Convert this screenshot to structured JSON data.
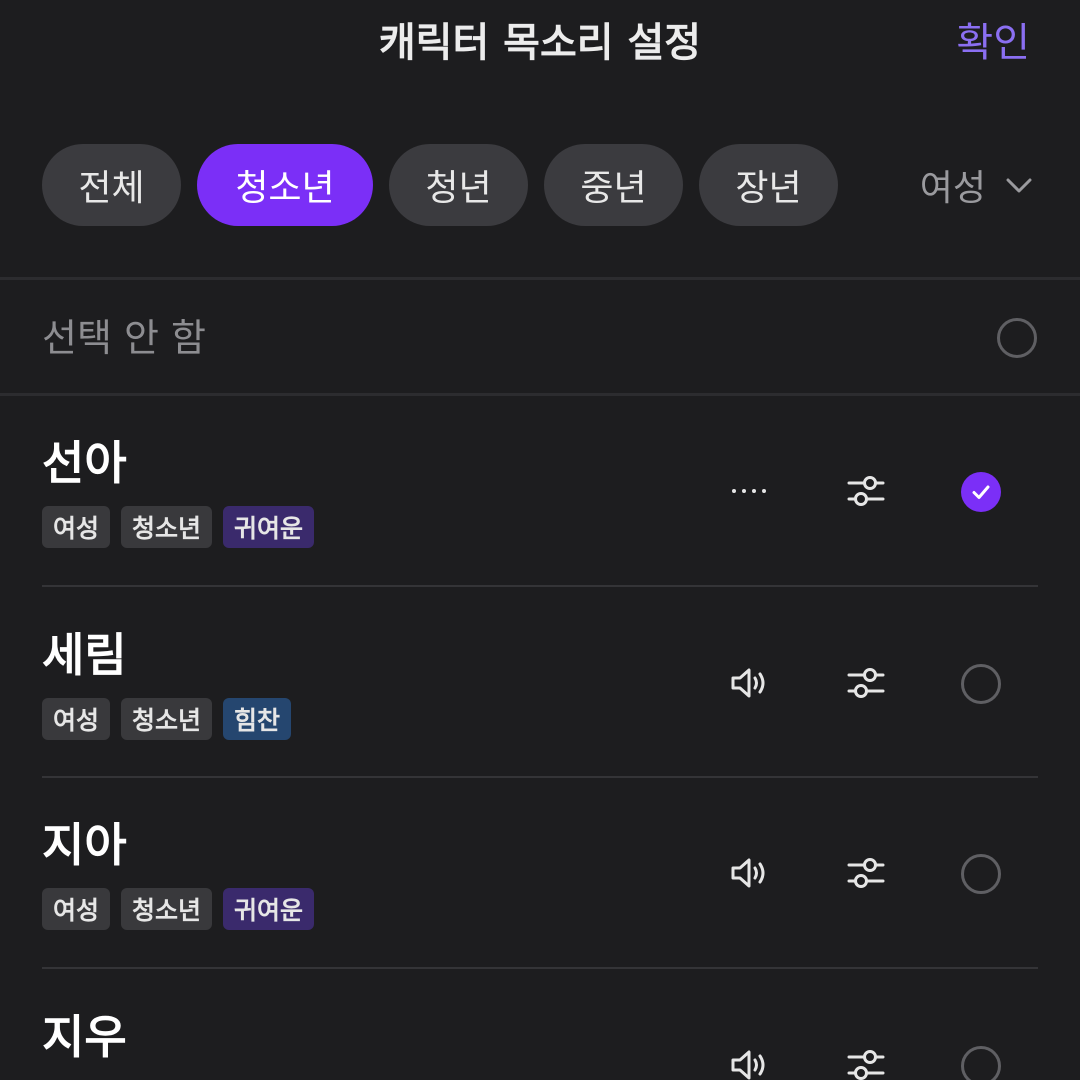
{
  "header": {
    "title": "캐릭터 목소리 설정",
    "confirm_label": "확인"
  },
  "filters": {
    "chips": [
      {
        "label": "전체",
        "active": false
      },
      {
        "label": "청소년",
        "active": true
      },
      {
        "label": "청년",
        "active": false
      },
      {
        "label": "중년",
        "active": false
      },
      {
        "label": "장년",
        "active": false
      }
    ],
    "gender_dropdown": {
      "selected": "여성",
      "icon": "chevron-down-icon"
    }
  },
  "none_option": {
    "label": "선택 안 함",
    "selected": false
  },
  "voices": [
    {
      "name": "선아",
      "tags": [
        "여성",
        "청소년",
        "귀여운"
      ],
      "playback_icon": "more-dots-icon",
      "selected": true
    },
    {
      "name": "세림",
      "tags": [
        "여성",
        "청소년",
        "힘찬"
      ],
      "playback_icon": "speaker-icon",
      "selected": false
    },
    {
      "name": "지아",
      "tags": [
        "여성",
        "청소년",
        "귀여운"
      ],
      "playback_icon": "speaker-icon",
      "selected": false
    },
    {
      "name": "지우",
      "tags": [],
      "playback_icon": "speaker-icon",
      "selected": false
    }
  ],
  "colors": {
    "accent": "#7b2ff7",
    "confirm": "#8b6ff2",
    "background": "#1d1d1f",
    "tag_cute": "#3a2a6c",
    "tag_strong": "#25466f"
  }
}
